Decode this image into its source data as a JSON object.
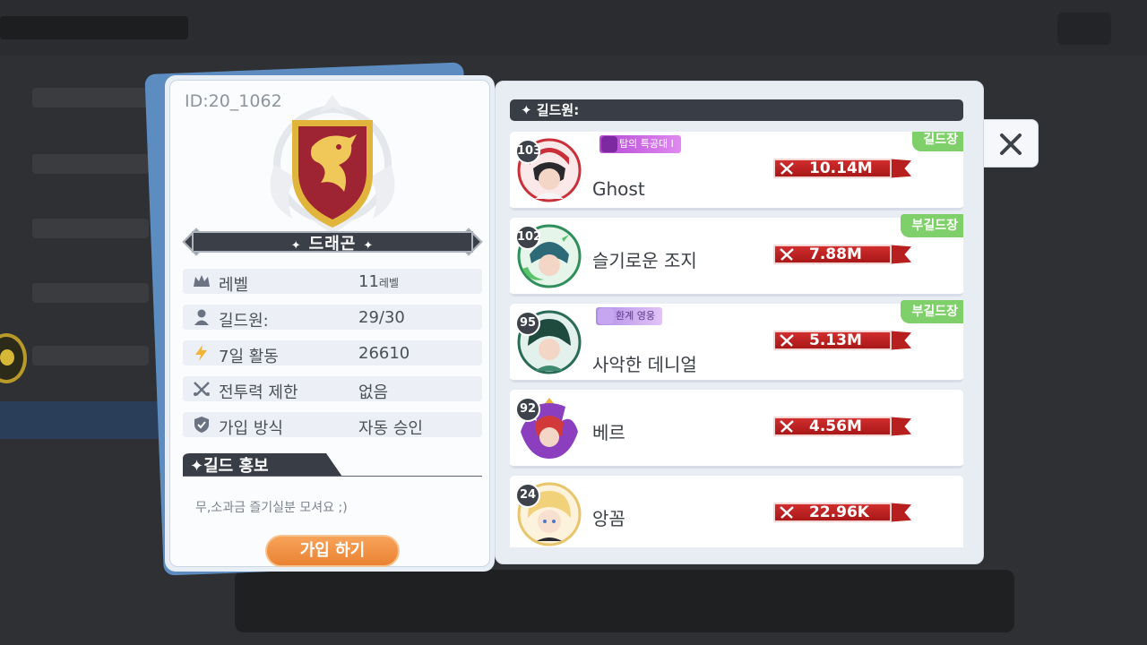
{
  "guild": {
    "id_text": "ID:20_1062",
    "name": "드래곤",
    "info_rows": [
      {
        "icon": "crown-icon",
        "label": "레벨",
        "value": "11",
        "unit": "레벨"
      },
      {
        "icon": "person-icon",
        "label": "길드원:",
        "value": "29/30",
        "unit": ""
      },
      {
        "icon": "lightning-icon",
        "label": "7일 활동",
        "value": "26610",
        "unit": ""
      },
      {
        "icon": "crossed-swords-icon",
        "label": "전투력 제한",
        "value": "없음",
        "unit": ""
      },
      {
        "icon": "shield-check-icon",
        "label": "가입 방식",
        "value": "자동 승인",
        "unit": ""
      }
    ],
    "promo_title": "길드 홍보",
    "promo_text": "무,소과금 즐기실분 모셔요 ;)",
    "join_label": "가입 하기"
  },
  "members_panel": {
    "header": "길드원:",
    "members": [
      {
        "level": "103",
        "name": "Ghost",
        "title": "탑의 특공대 I",
        "power": "10.14M",
        "rank": "길드장",
        "avatar_color": "#c9303a"
      },
      {
        "level": "102",
        "name": "슬기로운 조지",
        "title": "",
        "power": "7.88M",
        "rank": "부길드장",
        "avatar_color": "#2f8f5a"
      },
      {
        "level": "95",
        "name": "사악한 데니얼",
        "title": "환계 영웅",
        "power": "5.13M",
        "rank": "부길드장",
        "avatar_color": "#2a6b58"
      },
      {
        "level": "92",
        "name": "베르",
        "title": "",
        "power": "4.56M",
        "rank": "",
        "avatar_color": "#8b3fbf"
      },
      {
        "level": "24",
        "name": "앙꼼",
        "title": "",
        "power": "22.96K",
        "rank": "",
        "avatar_color": "#e8c56a"
      }
    ]
  },
  "colors": {
    "accent_orange": "#ea8332",
    "rank_green": "#7fd06a",
    "power_red": "#b81f1f",
    "dark_bar": "#393d45"
  }
}
